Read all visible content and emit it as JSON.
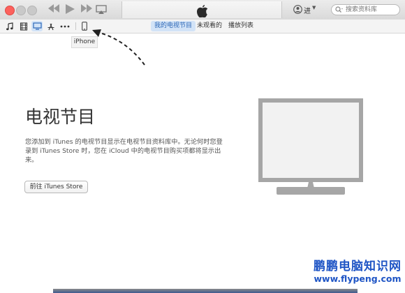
{
  "window": {
    "accent_color": "#2b67b6",
    "active_tab_bg": "#d2e3f7"
  },
  "playback": {
    "prev_icon": "rewind-icon",
    "play_icon": "play-icon",
    "next_icon": "fast-forward-icon",
    "airplay_icon": "airplay-icon"
  },
  "account": {
    "label": "进",
    "icon": "user-circle-icon"
  },
  "search": {
    "placeholder": "搜索资料库",
    "value": ""
  },
  "toolbar": {
    "media_icons": [
      "music-note-icon",
      "film-icon",
      "tv-icon",
      "app-store-icon",
      "more-icon",
      "iphone-icon"
    ],
    "tabs": [
      {
        "label": "我的电视节目",
        "active": true
      },
      {
        "label": "未观看的",
        "active": false
      },
      {
        "label": "播放列表",
        "active": false
      }
    ]
  },
  "tooltip": {
    "text": "iPhone"
  },
  "main": {
    "title": "电视节目",
    "description": "您添加到 iTunes 的电视节目显示在电视节目资料库中。无论何时您登录到 iTunes Store 时，您在 iCloud 中的电视节目购买项都将显示出来。",
    "button_label": "前往 iTunes Store"
  },
  "watermark": {
    "title": "鹏鹏电脑知识网",
    "url": "www.flypeng.com"
  }
}
